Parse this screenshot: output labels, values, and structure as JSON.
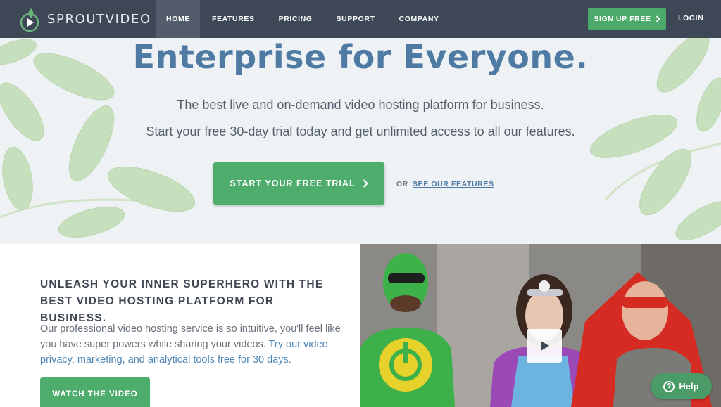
{
  "nav": {
    "brand": "SPROUTVIDEO",
    "items": [
      {
        "label": "HOME",
        "active": true
      },
      {
        "label": "FEATURES"
      },
      {
        "label": "PRICING"
      },
      {
        "label": "SUPPORT"
      },
      {
        "label": "COMPANY"
      }
    ],
    "signup_label": "SIGN UP FREE",
    "login_label": "LOGIN"
  },
  "hero": {
    "title": "Enterprise for Everyone.",
    "subtitle_1": "The best live and on-demand video hosting platform for business.",
    "subtitle_2": "Start your free 30-day trial today and get unlimited access to all our features.",
    "trial_button": "START YOUR FREE TRIAL",
    "or_text": "OR",
    "features_link": "SEE OUR FEATURES"
  },
  "promo": {
    "title": "UNLEASH YOUR INNER SUPERHERO WITH THE BEST VIDEO HOSTING PLATFORM FOR BUSINESS.",
    "body": "Our professional video hosting service is so intuitive, you'll feel like you have super powers while sharing your videos.",
    "body_link": "Try our video privacy, marketing, and analytical tools free for 30 days.",
    "watch_button": "WATCH THE VIDEO"
  },
  "help": {
    "label": "Help",
    "glyph": "?"
  },
  "icons": {
    "logo": "sprout-play-icon",
    "chevron": "chevron-right-icon",
    "play": "play-icon",
    "help": "question-circle-icon"
  },
  "colors": {
    "nav_bg": "#3e4756",
    "accent_green": "#4eac6c",
    "title_blue": "#4f7aa3",
    "hero_bg": "#eef2f5"
  }
}
